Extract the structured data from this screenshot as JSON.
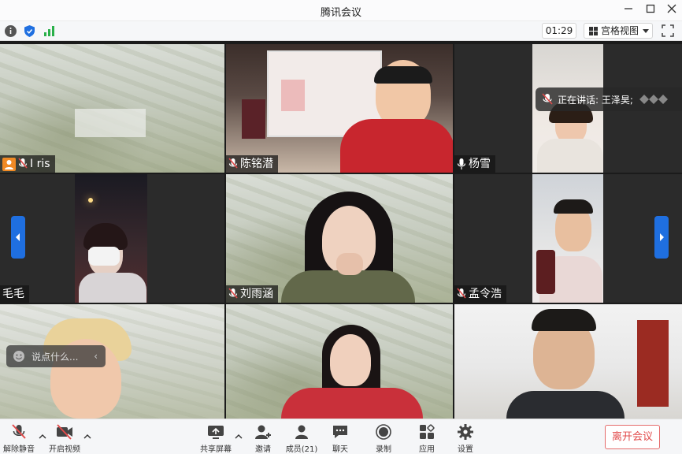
{
  "window": {
    "title": "腾讯会议"
  },
  "toolbar": {
    "timer": "01:29",
    "view_label": "宫格视图"
  },
  "participants": [
    {
      "name": "I ris"
    },
    {
      "name": "陈铭潜"
    },
    {
      "name": "杨雪"
    },
    {
      "name": "毛毛"
    },
    {
      "name": "刘雨涵"
    },
    {
      "name": "孟令浩"
    }
  ],
  "speaking": {
    "label": "正在讲话: 王泽昊;"
  },
  "chat": {
    "placeholder": "说点什么..."
  },
  "bottom": {
    "unmute": "解除静音",
    "start_video": "开启视频",
    "share_screen": "共享屏幕",
    "invite": "邀请",
    "members": "成员(21)",
    "chat": "聊天",
    "record": "录制",
    "apps": "应用",
    "settings": "设置",
    "leave": "离开会议"
  },
  "colors": {
    "accent": "#1f6fe0",
    "danger": "#e24b4b",
    "mic_muted": "#e24b4b"
  }
}
